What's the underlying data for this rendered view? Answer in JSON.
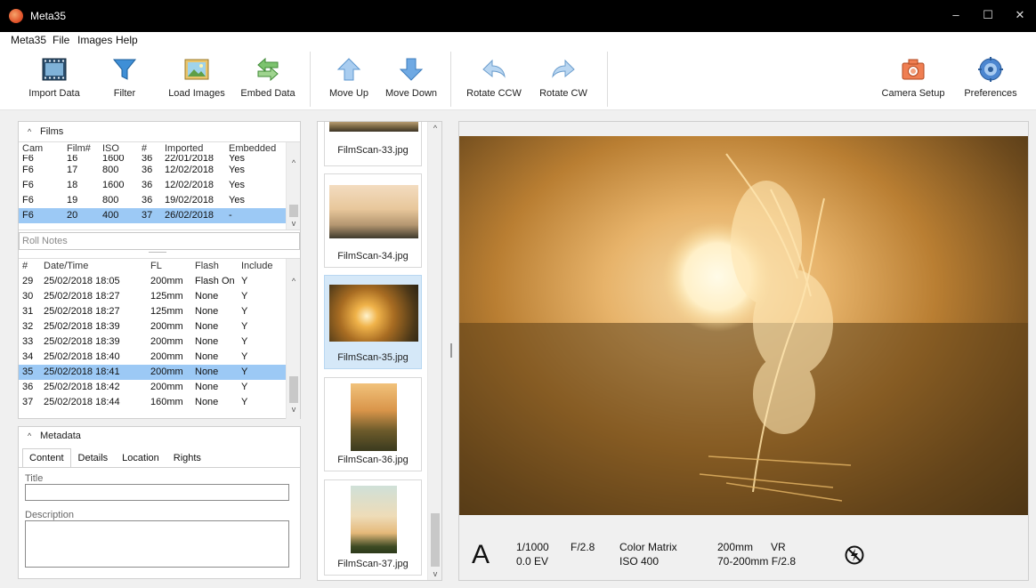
{
  "window": {
    "title": "Meta35",
    "icon": "meta35-logo-icon",
    "controls": [
      "minimize-icon",
      "maximize-icon",
      "close-icon"
    ]
  },
  "menu": [
    "Meta35",
    "File",
    "Images",
    "Help"
  ],
  "toolbar": [
    {
      "label": "Import Data",
      "icon": "film-strip-icon"
    },
    {
      "label": "Filter",
      "icon": "funnel-icon"
    },
    {
      "label": "Load Images",
      "icon": "picture-icon"
    },
    {
      "label": "Embed Data",
      "icon": "embed-arrows-icon"
    },
    {
      "label": "Move Up",
      "icon": "arrow-up-icon"
    },
    {
      "label": "Move Down",
      "icon": "arrow-down-icon"
    },
    {
      "label": "Rotate CCW",
      "icon": "rotate-ccw-icon"
    },
    {
      "label": "Rotate CW",
      "icon": "rotate-cw-icon"
    },
    {
      "label": "Camera Setup",
      "icon": "camera-icon"
    },
    {
      "label": "Preferences",
      "icon": "gear-icon"
    }
  ],
  "films": {
    "header": "Films",
    "columns": [
      "Cam",
      "Film#",
      "ISO",
      "#",
      "Imported",
      "Embedded"
    ],
    "rows": [
      [
        "F6",
        "16",
        "1600",
        "36",
        "22/01/2018",
        "Yes"
      ],
      [
        "F6",
        "17",
        "800",
        "36",
        "12/02/2018",
        "Yes"
      ],
      [
        "F6",
        "18",
        "1600",
        "36",
        "12/02/2018",
        "Yes"
      ],
      [
        "F6",
        "19",
        "800",
        "36",
        "19/02/2018",
        "Yes"
      ],
      [
        "F6",
        "20",
        "400",
        "37",
        "26/02/2018",
        "-"
      ]
    ],
    "selected_row": 4,
    "roll_notes_placeholder": "Roll Notes"
  },
  "frames": {
    "columns": [
      "#",
      "Date/Time",
      "FL",
      "Flash",
      "Include"
    ],
    "rows": [
      [
        "29",
        "25/02/2018 18:05",
        "200mm",
        "Flash On",
        "Y"
      ],
      [
        "30",
        "25/02/2018 18:27",
        "125mm",
        "None",
        "Y"
      ],
      [
        "31",
        "25/02/2018 18:27",
        "125mm",
        "None",
        "Y"
      ],
      [
        "32",
        "25/02/2018 18:39",
        "200mm",
        "None",
        "Y"
      ],
      [
        "33",
        "25/02/2018 18:39",
        "200mm",
        "None",
        "Y"
      ],
      [
        "34",
        "25/02/2018 18:40",
        "200mm",
        "None",
        "Y"
      ],
      [
        "35",
        "25/02/2018 18:41",
        "200mm",
        "None",
        "Y"
      ],
      [
        "36",
        "25/02/2018 18:42",
        "200mm",
        "None",
        "Y"
      ],
      [
        "37",
        "25/02/2018 18:44",
        "160mm",
        "None",
        "Y"
      ]
    ],
    "selected_row": 6
  },
  "metadata": {
    "header": "Metadata",
    "tabs": [
      "Content",
      "Details",
      "Location",
      "Rights"
    ],
    "active_tab": 0,
    "title_label": "Title",
    "title_value": "",
    "description_label": "Description",
    "description_value": ""
  },
  "thumbnails": [
    {
      "file": "FilmScan-33.jpg"
    },
    {
      "file": "FilmScan-34.jpg"
    },
    {
      "file": "FilmScan-35.jpg",
      "selected": true
    },
    {
      "file": "FilmScan-36.jpg"
    },
    {
      "file": "FilmScan-37.jpg"
    }
  ],
  "exposure": {
    "mode": "A",
    "shutter": "1/1000",
    "ev": "0.0 EV",
    "aperture": "F/2.8",
    "metering": "Color Matrix",
    "iso": "ISO 400",
    "focal": "200mm",
    "vr": "VR",
    "lens": "70-200mm F/2.8",
    "flash_icon": "flash-off-icon"
  }
}
